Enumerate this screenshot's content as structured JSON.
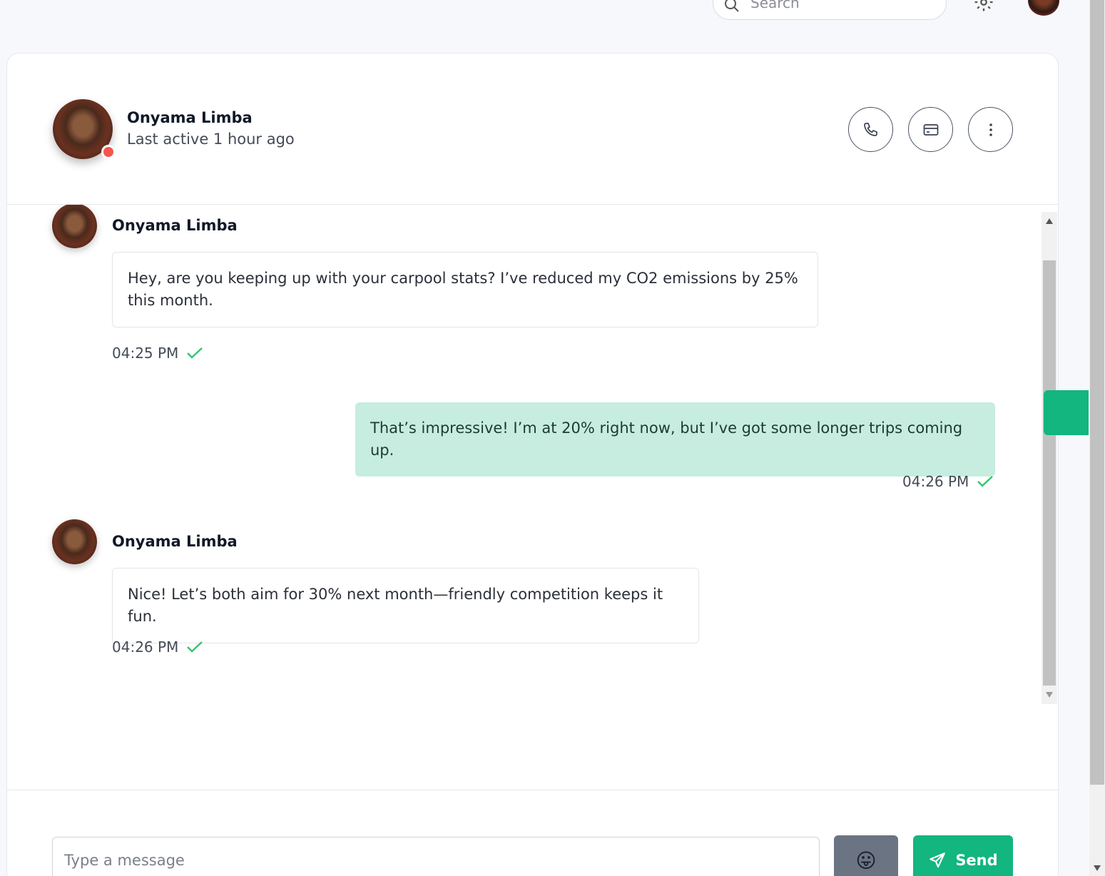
{
  "search": {
    "placeholder": "Search"
  },
  "contact": {
    "name": "Onyama Limba",
    "status": "Last active 1 hour ago"
  },
  "messages": [
    {
      "direction": "in",
      "sender": "Onyama Limba",
      "text": "Hey, are you keeping up with your carpool stats? I’ve reduced my CO2 emissions by 25% this month.",
      "time": "04:25 PM",
      "read": true
    },
    {
      "direction": "out",
      "text": "That’s impressive! I’m at 20% right now, but I’ve got some longer trips coming up.",
      "time": "04:26 PM",
      "read": true
    },
    {
      "direction": "in",
      "sender": "Onyama Limba",
      "text": "Nice! Let’s both aim for 30% next month—friendly competition keeps it fun.",
      "time": "04:26 PM",
      "read": true
    }
  ],
  "composer": {
    "placeholder": "Type a message",
    "send_label": "Send",
    "emoji": "😛"
  },
  "colors": {
    "accent": "#12b67e",
    "outgoing_bubble": "#c6eddf",
    "status_dot": "#f4564e"
  }
}
